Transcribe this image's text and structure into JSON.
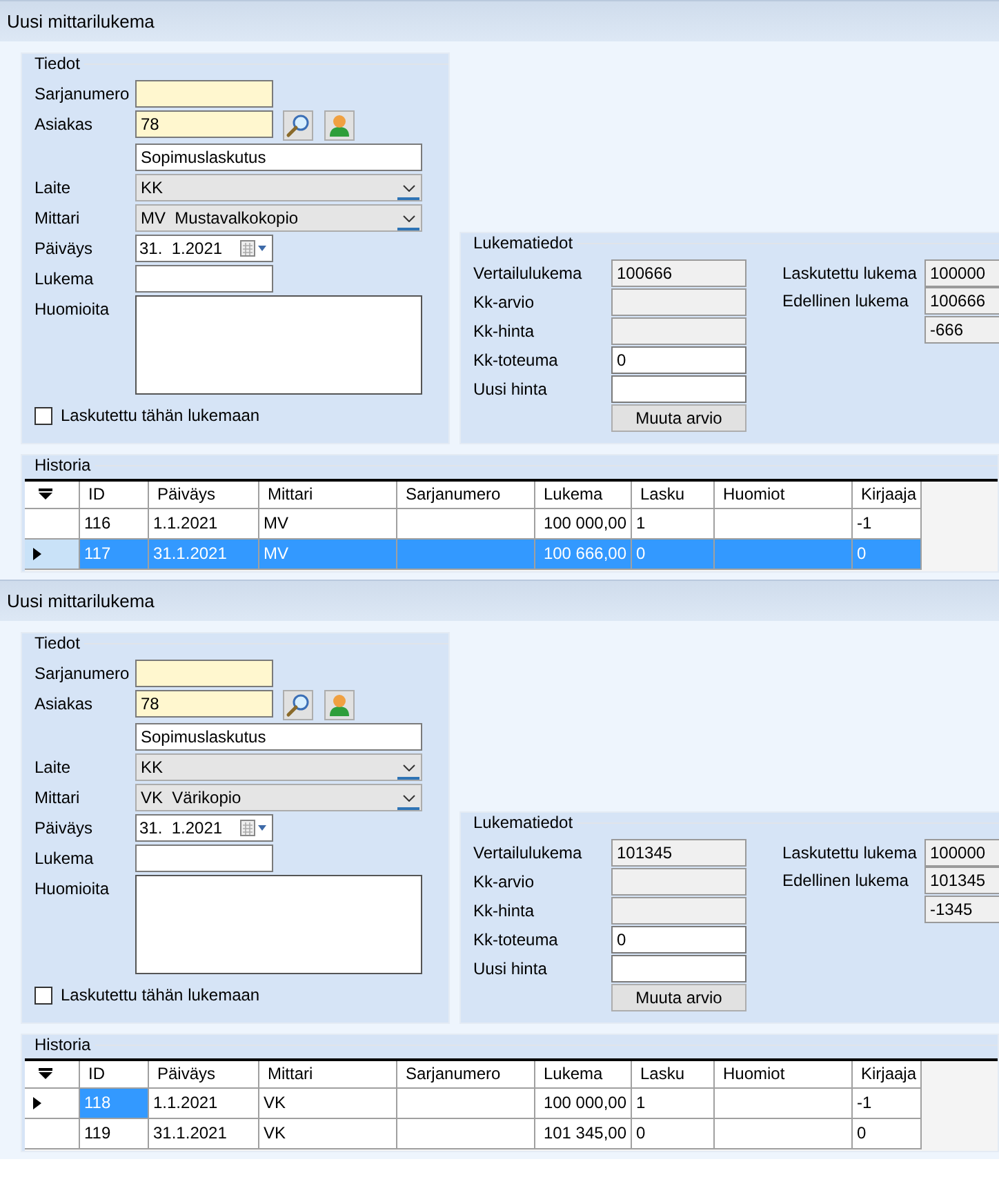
{
  "forms": [
    {
      "title": "Uusi mittarilukema",
      "details": {
        "title": "Tiedot",
        "serial": {
          "label": "Sarjanumero"
        },
        "customer": {
          "label": "Asiakas",
          "value": "78"
        },
        "contract": {
          "value": "Sopimuslaskutus"
        },
        "device": {
          "label": "Laite",
          "value": "KK"
        },
        "meter": {
          "label": "Mittari",
          "value": "MV  Mustavalkokopio"
        },
        "date": {
          "label": "Päiväys",
          "value": "31.  1.2021"
        },
        "reading": {
          "label": "Lukema"
        },
        "notes": {
          "label": "Huomioita"
        },
        "billed": {
          "label": "Laskutettu tähän lukemaan",
          "checked": false
        }
      },
      "readings": {
        "title": "Lukematiedot",
        "fields": [
          {
            "label": "Vertailulukema",
            "value": "100666",
            "disabled": true
          },
          {
            "label": "Kk-arvio",
            "disabled": true
          },
          {
            "label": "Kk-hinta",
            "disabled": true
          },
          {
            "label": "Kk-toteuma",
            "value": "0",
            "disabled": false
          },
          {
            "label": "Uusi hinta",
            "disabled": false
          }
        ],
        "button": "Muuta arvio",
        "side_fields": [
          {
            "label": "Laskutettu lukema",
            "value": "100000",
            "disabled": true
          },
          {
            "label": "Edellinen lukema",
            "value": "100666",
            "disabled": true
          },
          {
            "value": "-666",
            "disabled": true
          }
        ]
      },
      "history": {
        "title": "Historia",
        "columns": [
          {
            "label": "ID",
            "kind": "text"
          },
          {
            "label": "Päiväys",
            "kind": "text"
          },
          {
            "label": "Mittari",
            "kind": "text"
          },
          {
            "label": "Sarjanumero",
            "kind": "text"
          },
          {
            "label": "Lukema",
            "kind": "number"
          },
          {
            "label": "Lasku",
            "kind": "text"
          },
          {
            "label": "Huomiot",
            "kind": "text"
          },
          {
            "label": "Kirjaaja",
            "kind": "text"
          }
        ],
        "rows": [
          {
            "current": false,
            "selected": false,
            "cells": [
              {
                "text": "116",
                "selected": false
              },
              {
                "text": "1.1.2021",
                "selected": false
              },
              {
                "text": "MV",
                "selected": false
              },
              {
                "selected": false
              },
              {
                "text": "100 000,00",
                "selected": false
              },
              {
                "text": "1",
                "selected": false
              },
              {
                "selected": false
              },
              {
                "text": "-1",
                "selected": false
              }
            ]
          },
          {
            "current": true,
            "selected": true,
            "cells": [
              {
                "text": "117",
                "selected": true
              },
              {
                "text": "31.1.2021",
                "selected": true
              },
              {
                "text": "MV",
                "selected": true
              },
              {
                "selected": true
              },
              {
                "text": "100 666,00",
                "selected": true
              },
              {
                "text": "0",
                "selected": true
              },
              {
                "selected": true
              },
              {
                "text": "0",
                "selected": true
              }
            ]
          }
        ]
      }
    },
    {
      "title": "Uusi mittarilukema",
      "details": {
        "title": "Tiedot",
        "serial": {
          "label": "Sarjanumero"
        },
        "customer": {
          "label": "Asiakas",
          "value": "78"
        },
        "contract": {
          "value": "Sopimuslaskutus"
        },
        "device": {
          "label": "Laite",
          "value": "KK"
        },
        "meter": {
          "label": "Mittari",
          "value": "VK  Värikopio"
        },
        "date": {
          "label": "Päiväys",
          "value": "31.  1.2021"
        },
        "reading": {
          "label": "Lukema"
        },
        "notes": {
          "label": "Huomioita"
        },
        "billed": {
          "label": "Laskutettu tähän lukemaan",
          "checked": false
        }
      },
      "readings": {
        "title": "Lukematiedot",
        "fields": [
          {
            "label": "Vertailulukema",
            "value": "101345",
            "disabled": true
          },
          {
            "label": "Kk-arvio",
            "disabled": true
          },
          {
            "label": "Kk-hinta",
            "disabled": true
          },
          {
            "label": "Kk-toteuma",
            "value": "0",
            "disabled": false
          },
          {
            "label": "Uusi hinta",
            "disabled": false
          }
        ],
        "button": "Muuta arvio",
        "side_fields": [
          {
            "label": "Laskutettu lukema",
            "value": "100000",
            "disabled": true
          },
          {
            "label": "Edellinen lukema",
            "value": "101345",
            "disabled": true
          },
          {
            "value": "-1345",
            "disabled": true
          }
        ]
      },
      "history": {
        "title": "Historia",
        "columns": [
          {
            "label": "ID",
            "kind": "text"
          },
          {
            "label": "Päiväys",
            "kind": "text"
          },
          {
            "label": "Mittari",
            "kind": "text"
          },
          {
            "label": "Sarjanumero",
            "kind": "text"
          },
          {
            "label": "Lukema",
            "kind": "number"
          },
          {
            "label": "Lasku",
            "kind": "text"
          },
          {
            "label": "Huomiot",
            "kind": "text"
          },
          {
            "label": "Kirjaaja",
            "kind": "text"
          }
        ],
        "rows": [
          {
            "current": true,
            "selected": false,
            "cells": [
              {
                "text": "118",
                "selected": true
              },
              {
                "text": "1.1.2021",
                "selected": false
              },
              {
                "text": "VK",
                "selected": false
              },
              {
                "selected": false
              },
              {
                "text": "100 000,00",
                "selected": false
              },
              {
                "text": "1",
                "selected": false
              },
              {
                "selected": false
              },
              {
                "text": "-1",
                "selected": false
              }
            ]
          },
          {
            "current": false,
            "selected": false,
            "cells": [
              {
                "text": "119",
                "selected": false
              },
              {
                "text": "31.1.2021",
                "selected": false
              },
              {
                "text": "VK",
                "selected": false
              },
              {
                "selected": false
              },
              {
                "text": "101 345,00",
                "selected": false
              },
              {
                "text": "0",
                "selected": false
              },
              {
                "selected": false
              },
              {
                "text": "0",
                "selected": false
              }
            ]
          }
        ]
      }
    }
  ]
}
